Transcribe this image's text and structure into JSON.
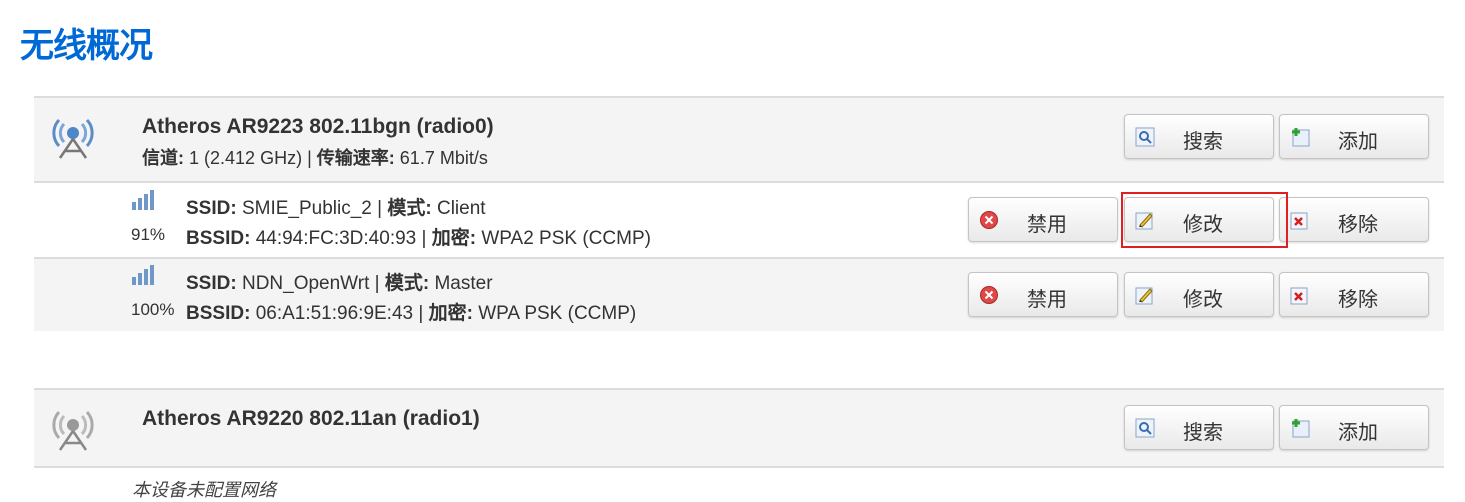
{
  "page": {
    "title": "无线概况"
  },
  "radios": [
    {
      "name": "Atheros AR9223 802.11bgn (radio0)",
      "channel_label": "信道:",
      "channel_value": "1 (2.412 GHz)",
      "rate_label": "传输速率:",
      "rate_value": "61.7 Mbit/s",
      "scan_label": "搜索",
      "add_label": "添加",
      "networks": [
        {
          "signal": "91%",
          "ssid_label": "SSID:",
          "ssid": "SMIE_Public_2",
          "mode_label": "模式:",
          "mode": "Client",
          "bssid_label": "BSSID:",
          "bssid": "44:94:FC:3D:40:93",
          "enc_label": "加密:",
          "enc": "WPA2 PSK (CCMP)",
          "disable_label": "禁用",
          "edit_label": "修改",
          "remove_label": "移除"
        },
        {
          "signal": "100%",
          "ssid_label": "SSID:",
          "ssid": "NDN_OpenWrt",
          "mode_label": "模式:",
          "mode": "Master",
          "bssid_label": "BSSID:",
          "bssid": "06:A1:51:96:9E:43",
          "enc_label": "加密:",
          "enc": "WPA PSK (CCMP)",
          "disable_label": "禁用",
          "edit_label": "修改",
          "remove_label": "移除"
        }
      ]
    },
    {
      "name": "Atheros AR9220 802.11an (radio1)",
      "scan_label": "搜索",
      "add_label": "添加",
      "empty_text": "本设备未配置网络"
    }
  ],
  "colors": {
    "title": "#0069d6",
    "highlight": "#e02020",
    "row_alt": "#f4f4f4"
  },
  "icons": {
    "radio": "wifi-radio-icon",
    "signal": "signal-strength-icon",
    "scan": "magnifier-icon",
    "add": "add-plus-icon",
    "disable": "disable-stop-icon",
    "edit": "edit-pencil-icon",
    "remove": "remove-x-icon"
  }
}
